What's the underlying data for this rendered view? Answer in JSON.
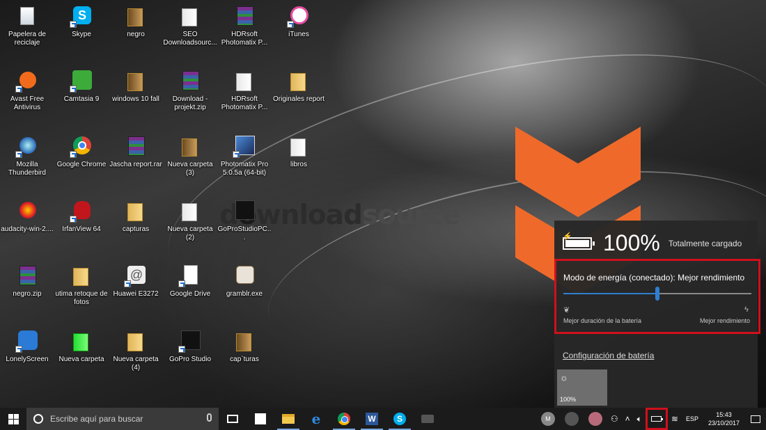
{
  "desktop": {
    "watermark": {
      "pre": "d",
      "mid": "wnload",
      "post": "source"
    },
    "icons": [
      {
        "label": "Papelera de reciclaje"
      },
      {
        "label": "Skype"
      },
      {
        "label": "negro"
      },
      {
        "label": "SEO Downloadsourc..."
      },
      {
        "label": "HDRsoft Photomatix P..."
      },
      {
        "label": "iTunes"
      },
      {
        "label": "Avast Free Antivirus"
      },
      {
        "label": "Camtasia 9"
      },
      {
        "label": "windows 10 fall"
      },
      {
        "label": "Download - projekt.zip"
      },
      {
        "label": "HDRsoft Photomatix P..."
      },
      {
        "label": "Originales report"
      },
      {
        "label": "Mozilla Thunderbird"
      },
      {
        "label": "Google Chrome"
      },
      {
        "label": "Jascha report.rar"
      },
      {
        "label": "Nueva carpeta (3)"
      },
      {
        "label": "Photomatix Pro 5.0.5a (64-bit)"
      },
      {
        "label": "libros"
      },
      {
        "label": "audacity-win-2...."
      },
      {
        "label": "IrfanView 64"
      },
      {
        "label": "capturas"
      },
      {
        "label": "Nueva carpeta (2)"
      },
      {
        "label": "GoProStudioPC..."
      },
      {
        "label": "negro.zip"
      },
      {
        "label": "utima retoque de fotos"
      },
      {
        "label": "Huawei E3272"
      },
      {
        "label": "Google Drive"
      },
      {
        "label": "gramblr.exe"
      },
      {
        "label": "LonelyScreen"
      },
      {
        "label": "Nueva carpeta"
      },
      {
        "label": "Nueva carpeta (4)"
      },
      {
        "label": "GoPro Studio"
      },
      {
        "label": "cap`turas"
      }
    ]
  },
  "battery_flyout": {
    "percent": "100%",
    "charge_level": 1.0,
    "status": "Totalmente cargado",
    "power_mode_title": "Modo de energía (conectado): Mejor rendimiento",
    "slider_value": 0.5,
    "left_label": "Mejor duración de la batería",
    "right_label": "Mejor rendimiento",
    "left_icon": "leaf-icon",
    "right_icon": "lightning-icon",
    "config_link": "Configuración de batería",
    "brightness_value": "100%",
    "brightness_icon": "sun-icon"
  },
  "taskbar": {
    "search_placeholder": "Escribe aquí para buscar",
    "apps": [
      "task-view",
      "store",
      "file-explorer",
      "edge",
      "chrome",
      "word",
      "skype",
      "media"
    ],
    "avatars": [
      "M"
    ],
    "language": "ESP",
    "time": "15:43",
    "date": "23/10/2017"
  },
  "colors": {
    "highlight": "#d0101c",
    "accent": "#2f7fd0",
    "flyout_bg": "#282828",
    "taskbar_bg": "#1b1b1b",
    "brand_orange": "#ef6a2a"
  }
}
